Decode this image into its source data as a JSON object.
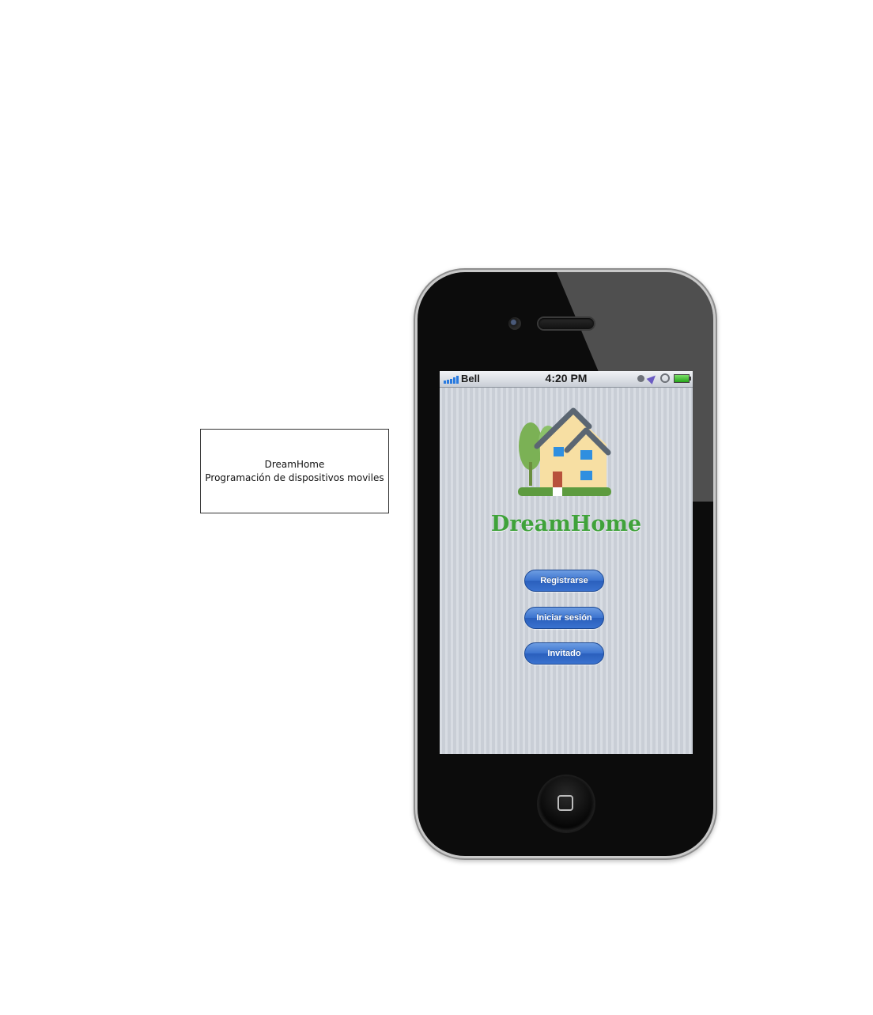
{
  "note": {
    "line1": "DreamHome",
    "line2": "Programación de dispositivos moviles"
  },
  "statusbar": {
    "carrier": "Bell",
    "time": "4:20 PM"
  },
  "app": {
    "title": "DreamHome",
    "buttons": [
      {
        "label": "Registrarse"
      },
      {
        "label": "Iniciar sesión"
      },
      {
        "label": "Invitado"
      }
    ]
  },
  "colors": {
    "title_green": "#3fa23a",
    "button_blue": "#3b73cf",
    "screen_bg": "#cfd5dd"
  }
}
